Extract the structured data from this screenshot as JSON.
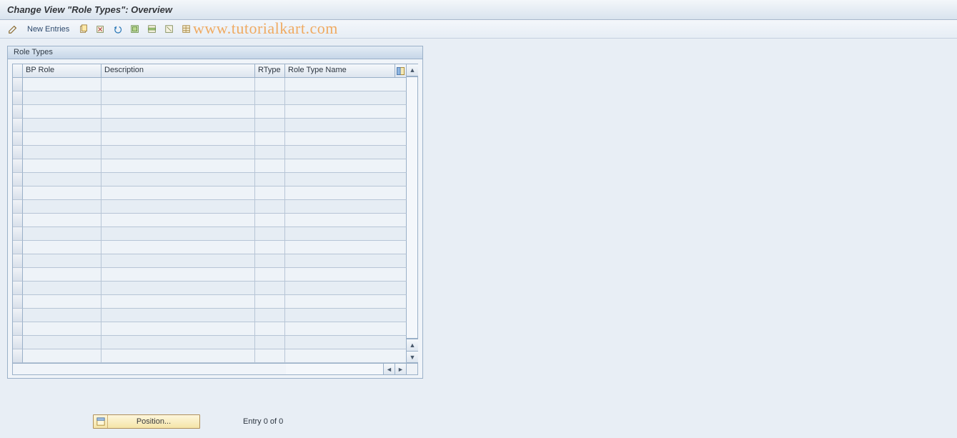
{
  "title": "Change View \"Role Types\": Overview",
  "toolbar": {
    "new_entries_label": "New Entries"
  },
  "watermark": "www.tutorialkart.com",
  "panel": {
    "title": "Role Types",
    "columns": {
      "bp_role": "BP Role",
      "description": "Description",
      "rtype": "RType",
      "role_type_name": "Role Type Name"
    },
    "rows": [
      {
        "bp_role": "",
        "description": "",
        "rtype": "",
        "role_type_name": ""
      },
      {
        "bp_role": "",
        "description": "",
        "rtype": "",
        "role_type_name": ""
      },
      {
        "bp_role": "",
        "description": "",
        "rtype": "",
        "role_type_name": ""
      },
      {
        "bp_role": "",
        "description": "",
        "rtype": "",
        "role_type_name": ""
      },
      {
        "bp_role": "",
        "description": "",
        "rtype": "",
        "role_type_name": ""
      },
      {
        "bp_role": "",
        "description": "",
        "rtype": "",
        "role_type_name": ""
      },
      {
        "bp_role": "",
        "description": "",
        "rtype": "",
        "role_type_name": ""
      },
      {
        "bp_role": "",
        "description": "",
        "rtype": "",
        "role_type_name": ""
      },
      {
        "bp_role": "",
        "description": "",
        "rtype": "",
        "role_type_name": ""
      },
      {
        "bp_role": "",
        "description": "",
        "rtype": "",
        "role_type_name": ""
      },
      {
        "bp_role": "",
        "description": "",
        "rtype": "",
        "role_type_name": ""
      },
      {
        "bp_role": "",
        "description": "",
        "rtype": "",
        "role_type_name": ""
      },
      {
        "bp_role": "",
        "description": "",
        "rtype": "",
        "role_type_name": ""
      },
      {
        "bp_role": "",
        "description": "",
        "rtype": "",
        "role_type_name": ""
      },
      {
        "bp_role": "",
        "description": "",
        "rtype": "",
        "role_type_name": ""
      },
      {
        "bp_role": "",
        "description": "",
        "rtype": "",
        "role_type_name": ""
      },
      {
        "bp_role": "",
        "description": "",
        "rtype": "",
        "role_type_name": ""
      },
      {
        "bp_role": "",
        "description": "",
        "rtype": "",
        "role_type_name": ""
      },
      {
        "bp_role": "",
        "description": "",
        "rtype": "",
        "role_type_name": ""
      },
      {
        "bp_role": "",
        "description": "",
        "rtype": "",
        "role_type_name": ""
      },
      {
        "bp_role": "",
        "description": "",
        "rtype": "",
        "role_type_name": ""
      }
    ]
  },
  "footer": {
    "position_label": "Position...",
    "entry_status": "Entry 0 of 0"
  }
}
